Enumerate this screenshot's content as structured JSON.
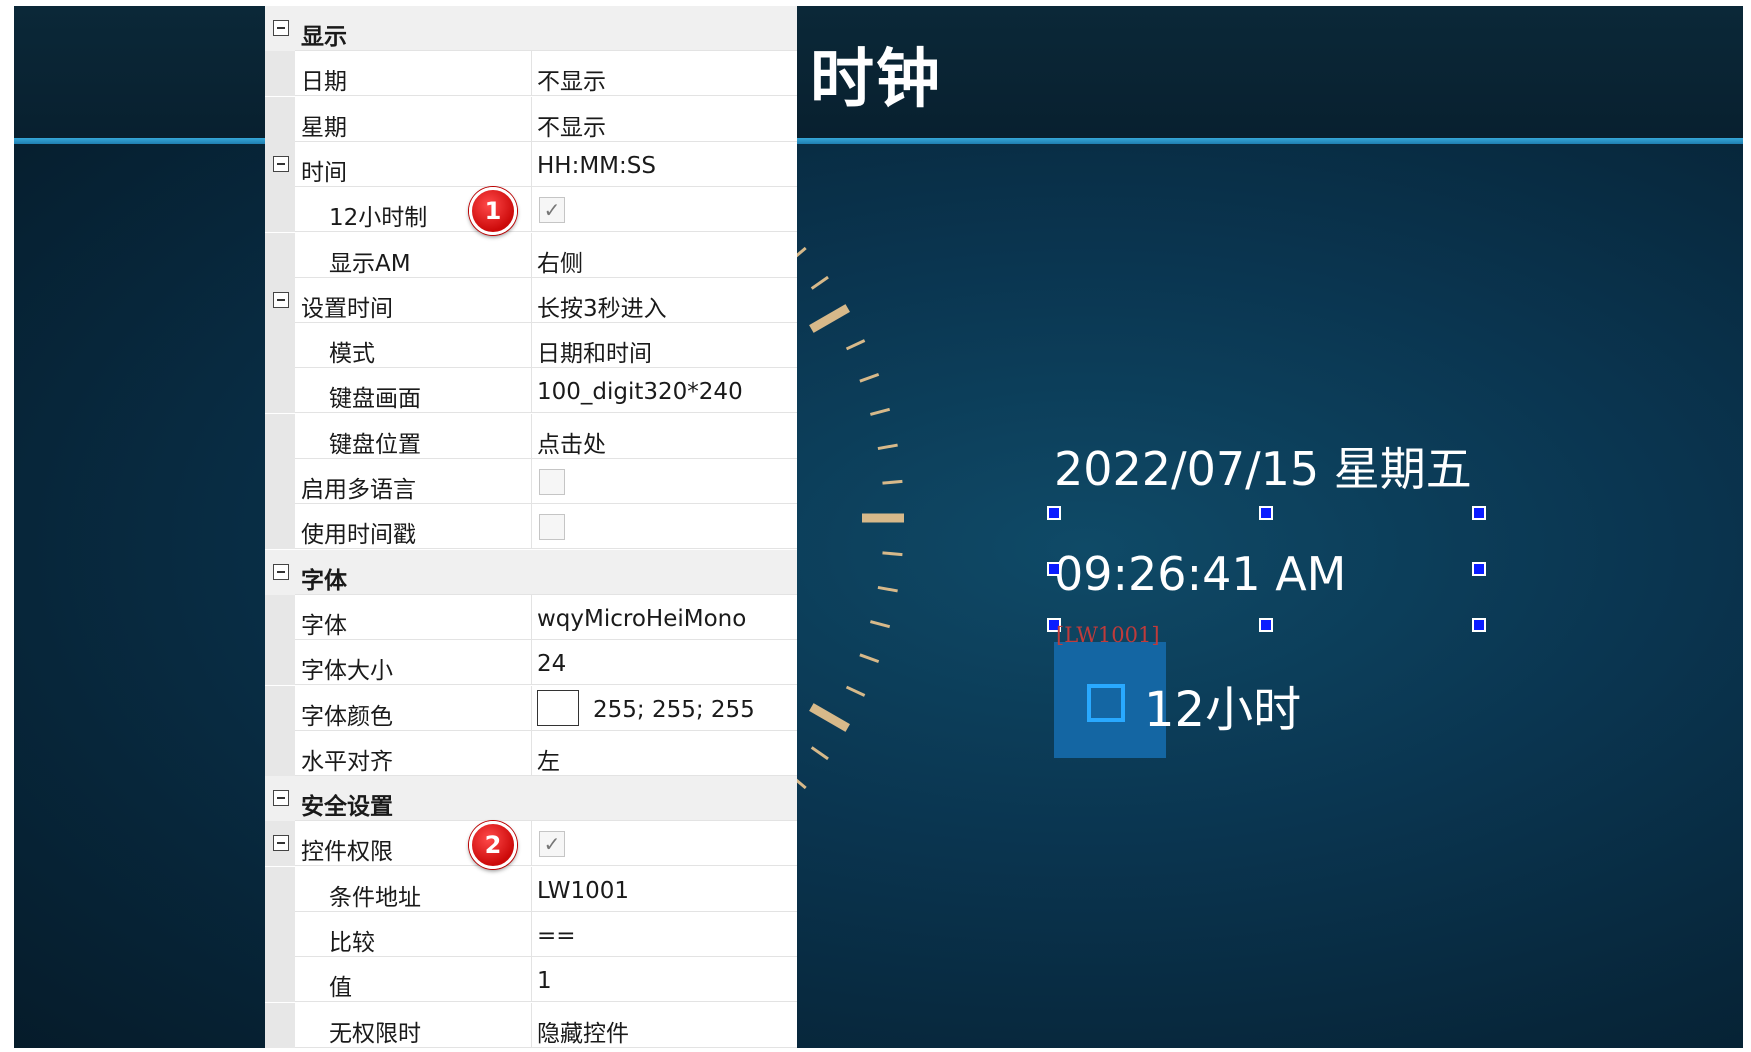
{
  "screen": {
    "title": "时钟",
    "date_display": "2022/07/15 星期五",
    "time_display": "09:26:41 AM",
    "permission_tag": "[LW1001]",
    "toggle_label": "12小时"
  },
  "property_grid": {
    "rows": [
      {
        "type": "category",
        "name": "显示",
        "value": ""
      },
      {
        "type": "property",
        "name": "日期",
        "value": "不显示"
      },
      {
        "type": "property",
        "name": "星期",
        "value": "不显示"
      },
      {
        "type": "group",
        "name": "时间",
        "value": "HH:MM:SS"
      },
      {
        "type": "sub",
        "name": "12小时制",
        "checkbox": true,
        "checked": true,
        "badge": "1"
      },
      {
        "type": "sub",
        "name": "显示AM",
        "value": "右侧"
      },
      {
        "type": "group",
        "name": "设置时间",
        "value": "长按3秒进入"
      },
      {
        "type": "sub",
        "name": "模式",
        "value": "日期和时间"
      },
      {
        "type": "sub",
        "name": "键盘画面",
        "value": "100_digit320*240"
      },
      {
        "type": "sub",
        "name": "键盘位置",
        "value": "点击处"
      },
      {
        "type": "property",
        "name": "启用多语言",
        "checkbox": true,
        "checked": false
      },
      {
        "type": "property",
        "name": "使用时间戳",
        "checkbox": true,
        "checked": false
      },
      {
        "type": "category",
        "name": "字体",
        "value": ""
      },
      {
        "type": "property",
        "name": "字体",
        "value": "wqyMicroHeiMono"
      },
      {
        "type": "property",
        "name": "字体大小",
        "value": "24"
      },
      {
        "type": "property",
        "name": "字体颜色",
        "value": "255; 255; 255",
        "swatch": "#ffffff"
      },
      {
        "type": "property",
        "name": "水平对齐",
        "value": "左"
      },
      {
        "type": "category",
        "name": "安全设置",
        "value": ""
      },
      {
        "type": "group",
        "name": "控件权限",
        "checkbox": true,
        "checked": true,
        "badge": "2"
      },
      {
        "type": "sub",
        "name": "条件地址",
        "value": "LW1001"
      },
      {
        "type": "sub",
        "name": "比较",
        "value": "=="
      },
      {
        "type": "sub",
        "name": "值",
        "value": "1"
      },
      {
        "type": "sub",
        "name": "无权限时",
        "value": "隐藏控件"
      }
    ]
  },
  "colors": {
    "header_line": "#36a7d8",
    "selection_handle": "#0b1cff",
    "badge": "#dd1111",
    "dial_tick": "#d7b98a"
  }
}
